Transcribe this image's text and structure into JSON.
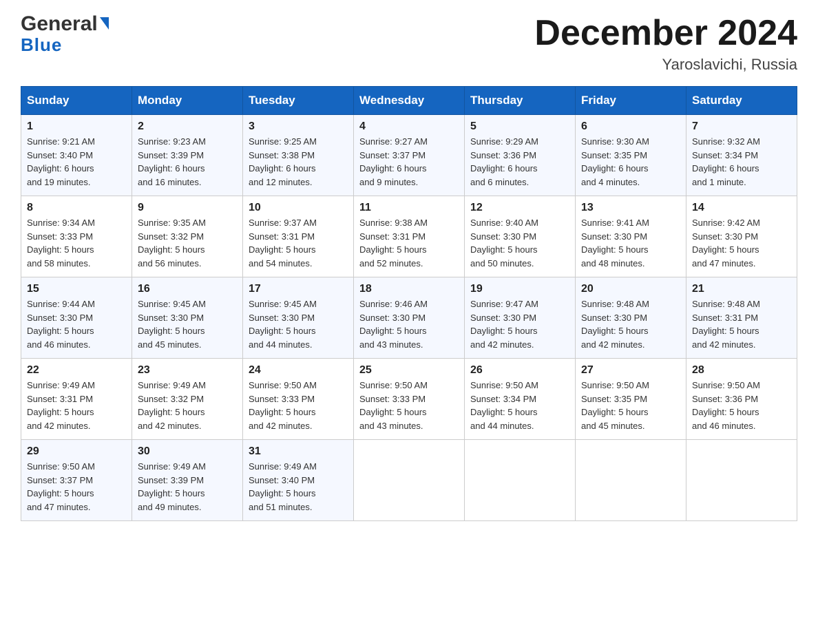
{
  "header": {
    "logo_general": "General",
    "logo_blue": "Blue",
    "month_title": "December 2024",
    "subtitle": "Yaroslavichi, Russia"
  },
  "days_of_week": [
    "Sunday",
    "Monday",
    "Tuesday",
    "Wednesday",
    "Thursday",
    "Friday",
    "Saturday"
  ],
  "weeks": [
    [
      {
        "day": "1",
        "sunrise": "9:21 AM",
        "sunset": "3:40 PM",
        "daylight": "6 hours and 19 minutes."
      },
      {
        "day": "2",
        "sunrise": "9:23 AM",
        "sunset": "3:39 PM",
        "daylight": "6 hours and 16 minutes."
      },
      {
        "day": "3",
        "sunrise": "9:25 AM",
        "sunset": "3:38 PM",
        "daylight": "6 hours and 12 minutes."
      },
      {
        "day": "4",
        "sunrise": "9:27 AM",
        "sunset": "3:37 PM",
        "daylight": "6 hours and 9 minutes."
      },
      {
        "day": "5",
        "sunrise": "9:29 AM",
        "sunset": "3:36 PM",
        "daylight": "6 hours and 6 minutes."
      },
      {
        "day": "6",
        "sunrise": "9:30 AM",
        "sunset": "3:35 PM",
        "daylight": "6 hours and 4 minutes."
      },
      {
        "day": "7",
        "sunrise": "9:32 AM",
        "sunset": "3:34 PM",
        "daylight": "6 hours and 1 minute."
      }
    ],
    [
      {
        "day": "8",
        "sunrise": "9:34 AM",
        "sunset": "3:33 PM",
        "daylight": "5 hours and 58 minutes."
      },
      {
        "day": "9",
        "sunrise": "9:35 AM",
        "sunset": "3:32 PM",
        "daylight": "5 hours and 56 minutes."
      },
      {
        "day": "10",
        "sunrise": "9:37 AM",
        "sunset": "3:31 PM",
        "daylight": "5 hours and 54 minutes."
      },
      {
        "day": "11",
        "sunrise": "9:38 AM",
        "sunset": "3:31 PM",
        "daylight": "5 hours and 52 minutes."
      },
      {
        "day": "12",
        "sunrise": "9:40 AM",
        "sunset": "3:30 PM",
        "daylight": "5 hours and 50 minutes."
      },
      {
        "day": "13",
        "sunrise": "9:41 AM",
        "sunset": "3:30 PM",
        "daylight": "5 hours and 48 minutes."
      },
      {
        "day": "14",
        "sunrise": "9:42 AM",
        "sunset": "3:30 PM",
        "daylight": "5 hours and 47 minutes."
      }
    ],
    [
      {
        "day": "15",
        "sunrise": "9:44 AM",
        "sunset": "3:30 PM",
        "daylight": "5 hours and 46 minutes."
      },
      {
        "day": "16",
        "sunrise": "9:45 AM",
        "sunset": "3:30 PM",
        "daylight": "5 hours and 45 minutes."
      },
      {
        "day": "17",
        "sunrise": "9:45 AM",
        "sunset": "3:30 PM",
        "daylight": "5 hours and 44 minutes."
      },
      {
        "day": "18",
        "sunrise": "9:46 AM",
        "sunset": "3:30 PM",
        "daylight": "5 hours and 43 minutes."
      },
      {
        "day": "19",
        "sunrise": "9:47 AM",
        "sunset": "3:30 PM",
        "daylight": "5 hours and 42 minutes."
      },
      {
        "day": "20",
        "sunrise": "9:48 AM",
        "sunset": "3:30 PM",
        "daylight": "5 hours and 42 minutes."
      },
      {
        "day": "21",
        "sunrise": "9:48 AM",
        "sunset": "3:31 PM",
        "daylight": "5 hours and 42 minutes."
      }
    ],
    [
      {
        "day": "22",
        "sunrise": "9:49 AM",
        "sunset": "3:31 PM",
        "daylight": "5 hours and 42 minutes."
      },
      {
        "day": "23",
        "sunrise": "9:49 AM",
        "sunset": "3:32 PM",
        "daylight": "5 hours and 42 minutes."
      },
      {
        "day": "24",
        "sunrise": "9:50 AM",
        "sunset": "3:33 PM",
        "daylight": "5 hours and 42 minutes."
      },
      {
        "day": "25",
        "sunrise": "9:50 AM",
        "sunset": "3:33 PM",
        "daylight": "5 hours and 43 minutes."
      },
      {
        "day": "26",
        "sunrise": "9:50 AM",
        "sunset": "3:34 PM",
        "daylight": "5 hours and 44 minutes."
      },
      {
        "day": "27",
        "sunrise": "9:50 AM",
        "sunset": "3:35 PM",
        "daylight": "5 hours and 45 minutes."
      },
      {
        "day": "28",
        "sunrise": "9:50 AM",
        "sunset": "3:36 PM",
        "daylight": "5 hours and 46 minutes."
      }
    ],
    [
      {
        "day": "29",
        "sunrise": "9:50 AM",
        "sunset": "3:37 PM",
        "daylight": "5 hours and 47 minutes."
      },
      {
        "day": "30",
        "sunrise": "9:49 AM",
        "sunset": "3:39 PM",
        "daylight": "5 hours and 49 minutes."
      },
      {
        "day": "31",
        "sunrise": "9:49 AM",
        "sunset": "3:40 PM",
        "daylight": "5 hours and 51 minutes."
      },
      null,
      null,
      null,
      null
    ]
  ],
  "labels": {
    "sunrise": "Sunrise:",
    "sunset": "Sunset:",
    "daylight": "Daylight:"
  }
}
